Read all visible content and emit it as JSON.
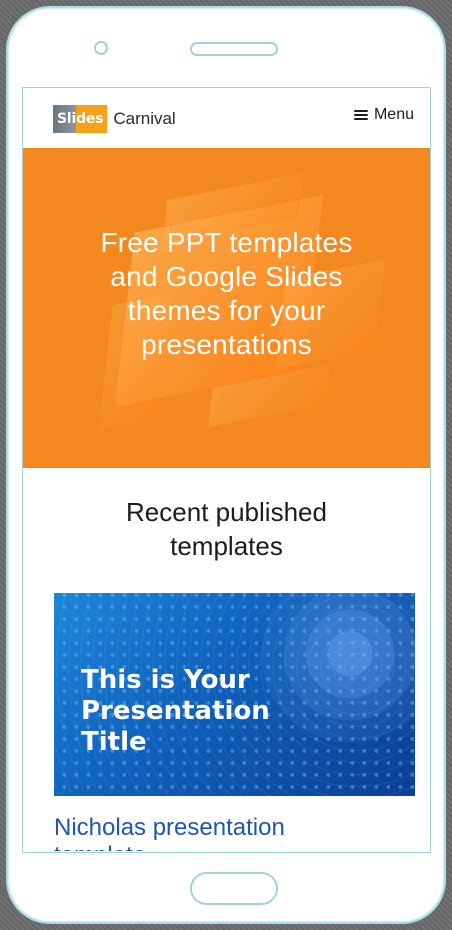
{
  "brand": {
    "logo_prefix_a": "Sli",
    "logo_prefix_b": "des",
    "logo_suffix": "Carnival"
  },
  "nav": {
    "menu_label": "Menu"
  },
  "hero": {
    "title": "Free PPT templates\nand Google Slides\nthemes for your\npresentations"
  },
  "section": {
    "title": "Recent published\ntemplates"
  },
  "template": {
    "preview_title": "This is Your\nPresentation Title",
    "name": "Nicholas presentation",
    "name_cutoff": "templates"
  },
  "icons": {
    "menu": "hamburger-menu-icon"
  },
  "colors": {
    "phone_outline": "#a9dee5",
    "hero_orange": "#f2881e",
    "brand_gray": "#6b7482",
    "brand_orange": "#f6a01c",
    "link_blue": "#1f56b6",
    "card_blue": "#0f5fba"
  }
}
